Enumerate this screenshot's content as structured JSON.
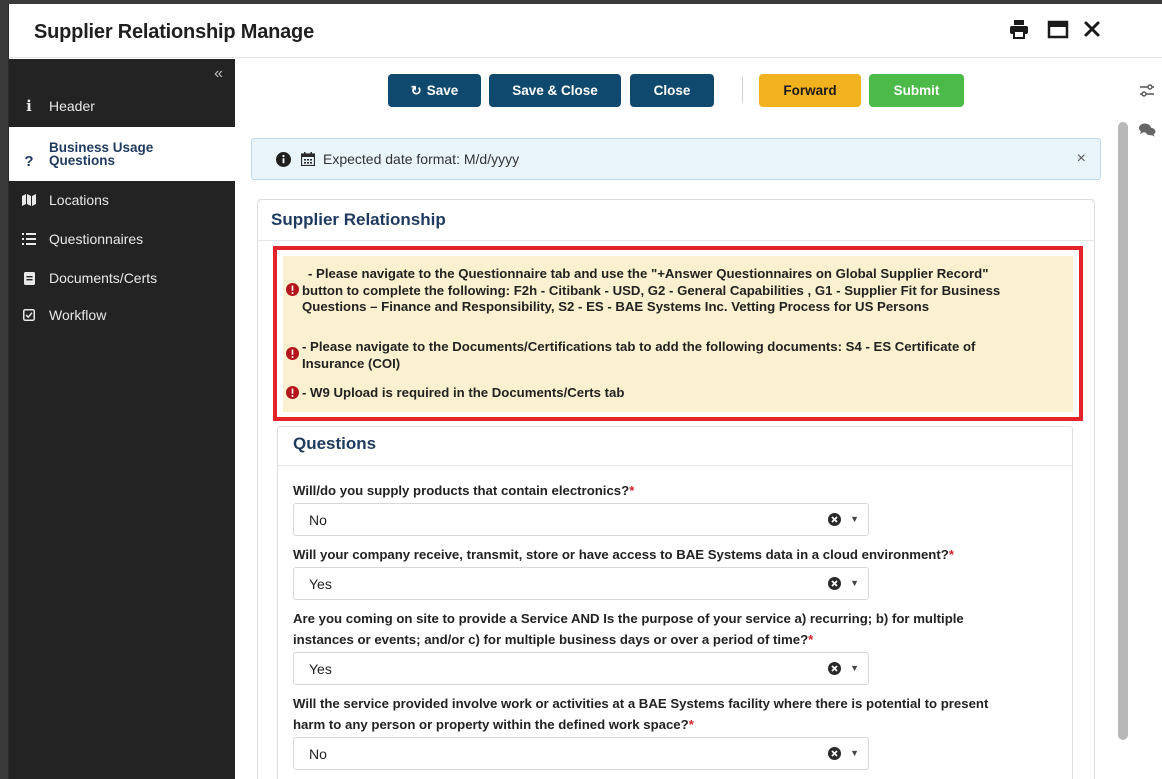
{
  "window": {
    "title": "Supplier Relationship Manage"
  },
  "sidebar": {
    "collapse_icon": "double-chevron-left-icon",
    "items": [
      {
        "label": "Header",
        "icon": "info-icon"
      },
      {
        "label": "Business Usage Questions",
        "label_line1": "Business Usage",
        "label_line2": "Questions",
        "icon": "question-icon",
        "active": true
      },
      {
        "label": "Locations",
        "icon": "map-icon"
      },
      {
        "label": "Questionnaires",
        "icon": "list-icon"
      },
      {
        "label": "Documents/Certs",
        "icon": "document-icon"
      },
      {
        "label": "Workflow",
        "icon": "checkbox-icon"
      }
    ]
  },
  "toolbar": {
    "save_label": "Save",
    "save_close_label": "Save & Close",
    "close_label": "Close",
    "forward_label": "Forward",
    "submit_label": "Submit"
  },
  "info_banner": {
    "text": "Expected date format: M/d/yyyy",
    "close_glyph": "×"
  },
  "card": {
    "title": "Supplier Relationship"
  },
  "alerts": [
    {
      "line1": "- Please navigate to the Questionnaire tab and use the \"+Answer Questionnaires on Global Supplier Record\"",
      "line2": "button to complete the following: F2h - Citibank - USD, G2 - General Capabilities , G1 - Supplier Fit for Business",
      "line3": "Questions – Finance and Responsibility, S2 - ES - BAE Systems Inc. Vetting Process for US Persons"
    },
    {
      "line1": "- Please navigate to the Documents/Certifications tab to add the following documents: S4 - ES Certificate of",
      "line2": "Insurance (COI)"
    },
    {
      "line1": "- W9 Upload is required in the Documents/Certs tab"
    }
  ],
  "questions": {
    "heading": "Questions",
    "required_marker": "*",
    "items": [
      {
        "line1": "Will/do you supply products that contain electronics?",
        "line2": "",
        "value": "No"
      },
      {
        "line1": "Will your company receive, transmit, store or have access to BAE Systems data in a cloud environment?",
        "line2": "",
        "value": "Yes"
      },
      {
        "line1": "Are you coming on site to provide a Service AND Is the purpose of your service a) recurring; b) for multiple",
        "line2": "instances or events; and/or c) for multiple business days or over a period of time?",
        "value": "Yes"
      },
      {
        "line1": "Will the service provided involve work or activities at a BAE Systems facility where there is potential to present",
        "line2": "harm to any person or property within the defined work space?",
        "value": "No"
      }
    ]
  },
  "colors": {
    "primary_button": "#0f4a6e",
    "forward_button": "#f2b11f",
    "submit_button": "#4cba48",
    "alert_border": "#e3252b",
    "alert_background": "#fbf0cf",
    "heading": "#1e3a5f",
    "sidebar": "#232323"
  }
}
